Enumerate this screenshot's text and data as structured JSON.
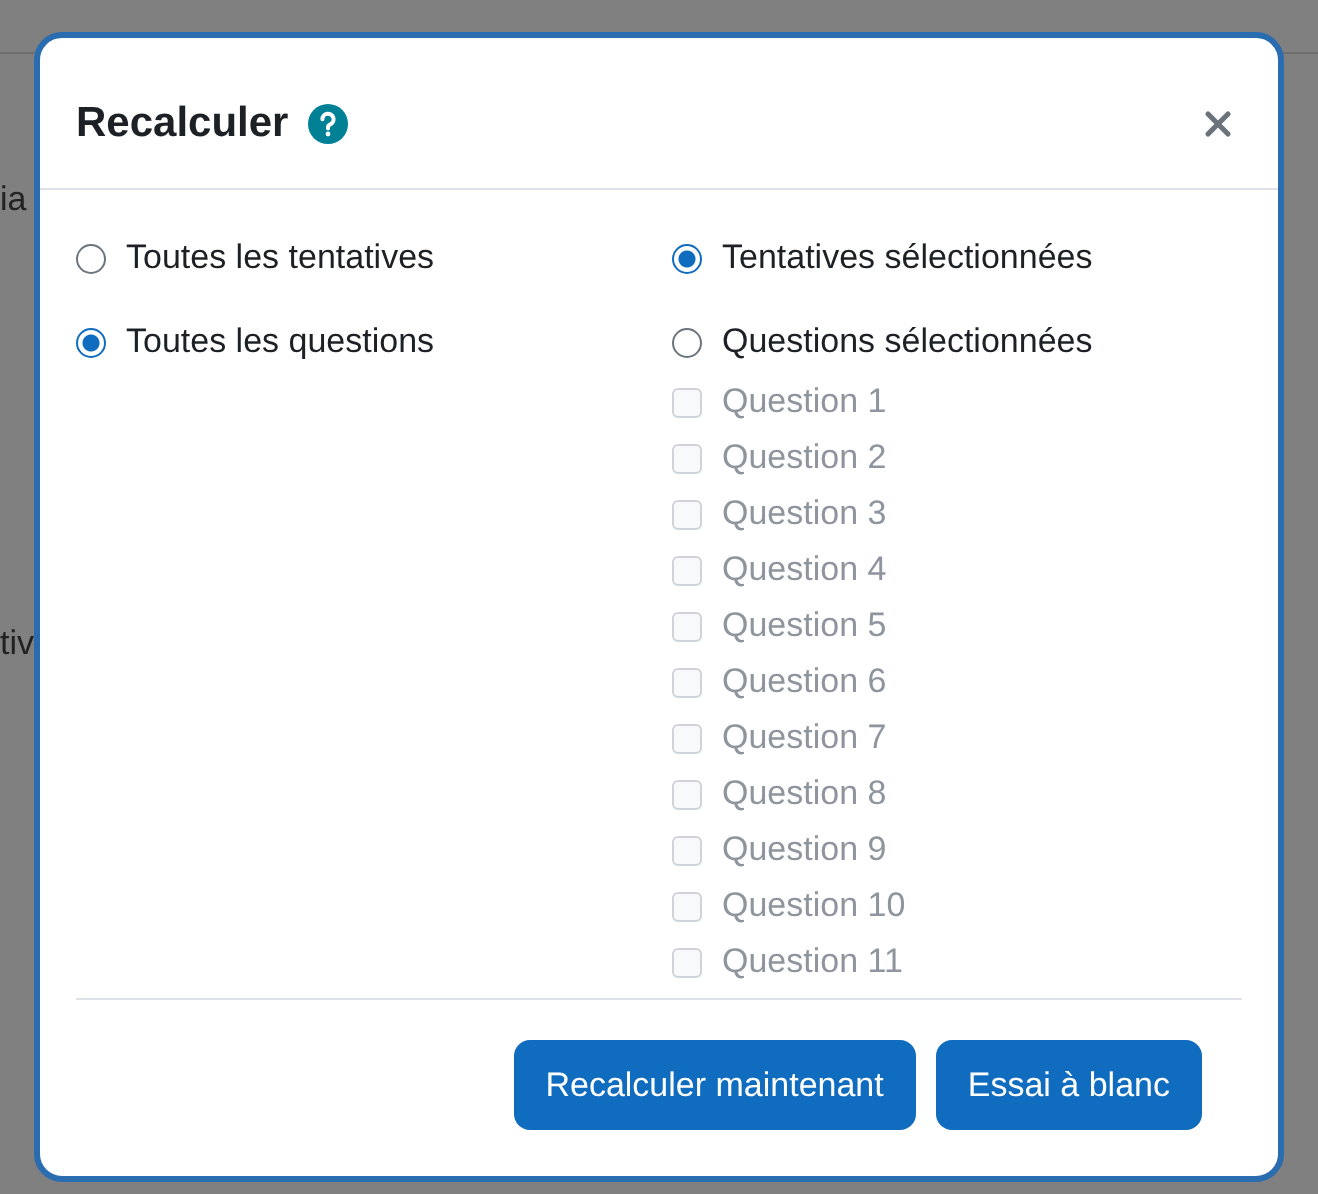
{
  "backdrop": {
    "fragments": [
      "ia",
      "tiv"
    ]
  },
  "dialog": {
    "title": "Recalculer",
    "attempt_options": [
      {
        "label": "Toutes les tentatives",
        "selected": false
      },
      {
        "label": "Tentatives sélectionnées",
        "selected": true
      }
    ],
    "question_options": [
      {
        "label": "Toutes les questions",
        "selected": true
      },
      {
        "label": "Questions sélectionnées",
        "selected": false
      }
    ],
    "questions": [
      {
        "label": "Question 1",
        "checked": false,
        "disabled": true
      },
      {
        "label": "Question 2",
        "checked": false,
        "disabled": true
      },
      {
        "label": "Question 3",
        "checked": false,
        "disabled": true
      },
      {
        "label": "Question 4",
        "checked": false,
        "disabled": true
      },
      {
        "label": "Question 5",
        "checked": false,
        "disabled": true
      },
      {
        "label": "Question 6",
        "checked": false,
        "disabled": true
      },
      {
        "label": "Question 7",
        "checked": false,
        "disabled": true
      },
      {
        "label": "Question 8",
        "checked": false,
        "disabled": true
      },
      {
        "label": "Question 9",
        "checked": false,
        "disabled": true
      },
      {
        "label": "Question 10",
        "checked": false,
        "disabled": true
      },
      {
        "label": "Question 11",
        "checked": false,
        "disabled": true
      }
    ],
    "buttons": [
      "Recalculer maintenant",
      "Essai à blanc"
    ]
  }
}
